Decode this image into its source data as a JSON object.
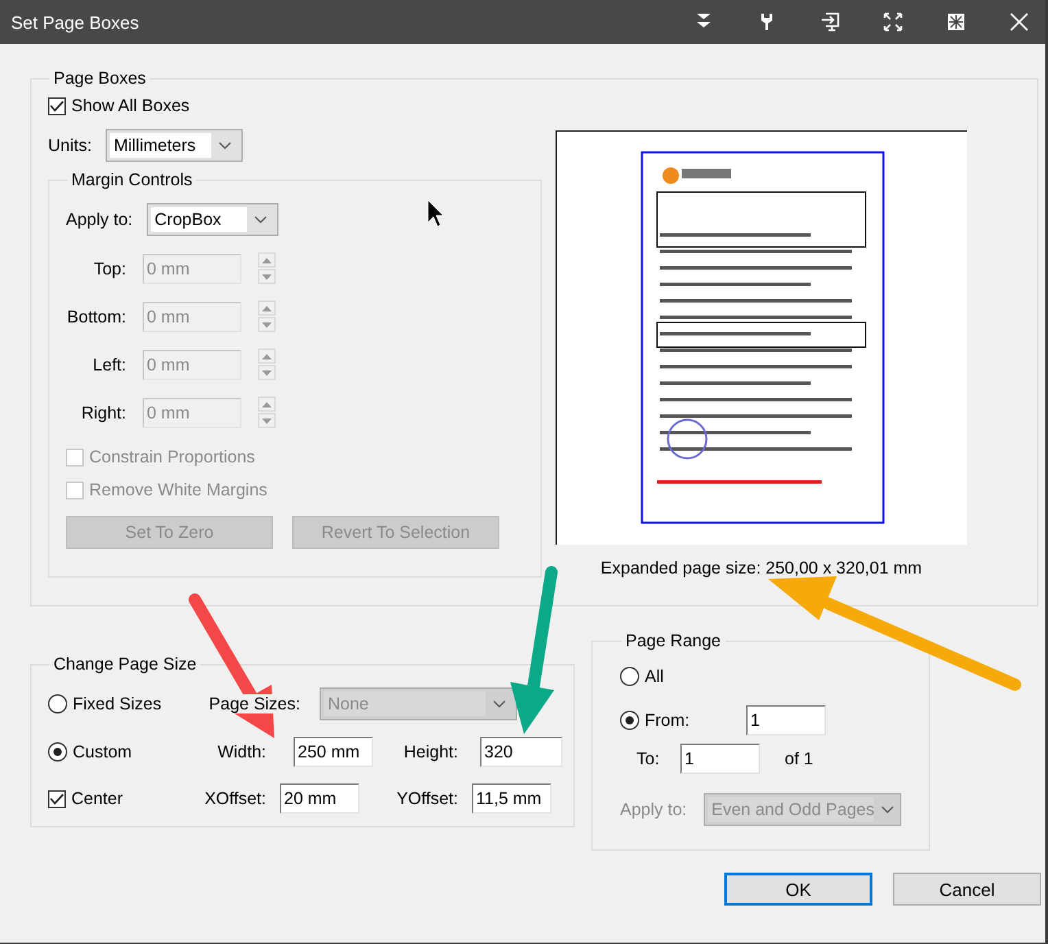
{
  "window": {
    "title": "Set Page Boxes"
  },
  "page_boxes": {
    "title": "Page Boxes",
    "show_all_boxes": {
      "label": "Show All Boxes",
      "checked": true
    },
    "units": {
      "label": "Units:",
      "value": "Millimeters"
    },
    "margin_controls": {
      "title": "Margin Controls",
      "disabled": true,
      "apply_to": {
        "label": "Apply to:",
        "value": "CropBox"
      },
      "fields": [
        {
          "label": "Top:",
          "value": "0 mm"
        },
        {
          "label": "Bottom:",
          "value": "0 mm"
        },
        {
          "label": "Left:",
          "value": "0 mm"
        },
        {
          "label": "Right:",
          "value": "0 mm"
        }
      ],
      "options": [
        {
          "label": "Constrain Proportions",
          "checked": false
        },
        {
          "label": "Remove White Margins",
          "checked": false
        }
      ],
      "buttons": [
        "Set To Zero",
        "Revert To Selection"
      ]
    },
    "preview": {
      "caption": "Expanded page size: 250,00 x 320,01 mm"
    }
  },
  "change_page_size": {
    "title": "Change Page Size",
    "modes": [
      {
        "label": "Fixed Sizes",
        "selected": false
      },
      {
        "label": "Custom",
        "selected": true
      }
    ],
    "page_sizes": {
      "label": "Page Sizes:",
      "value": "None",
      "disabled": true
    },
    "width": {
      "label": "Width:",
      "value": "250 mm"
    },
    "height": {
      "label": "Height:",
      "value": "320"
    },
    "center": {
      "label": "Center",
      "checked": true
    },
    "xoffset": {
      "label": "XOffset:",
      "value": "20 mm"
    },
    "yoffset": {
      "label": "YOffset:",
      "value": "11,5 mm"
    }
  },
  "page_range": {
    "title": "Page Range",
    "modes": [
      {
        "label": "All",
        "selected": false
      },
      {
        "label": "From:",
        "selected": true
      }
    ],
    "from": "1",
    "to": {
      "label": "To:",
      "value": "1"
    },
    "of": "of 1",
    "apply_to": {
      "label": "Apply to:",
      "value": "Even and Odd Pages",
      "disabled": true
    }
  },
  "buttons": [
    {
      "label": "OK",
      "default": true
    },
    {
      "label": "Cancel",
      "default": false
    }
  ]
}
